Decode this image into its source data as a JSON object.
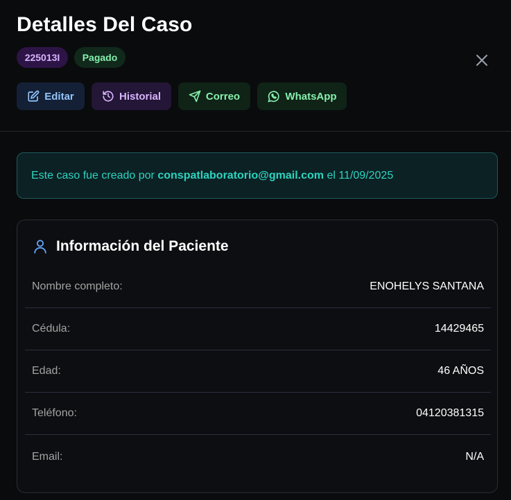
{
  "modal": {
    "title": "Detalles Del Caso",
    "case_id": "225013I",
    "status": "Pagado"
  },
  "actions": {
    "edit": "Editar",
    "history": "Historial",
    "email": "Correo",
    "whatsapp": "WhatsApp"
  },
  "notice": {
    "prefix": "Este caso fue creado por",
    "email": "conspatlaboratorio@gmail.com",
    "suffix": "el 11/09/2025"
  },
  "patient": {
    "title": "Información del Paciente",
    "fields": [
      {
        "label": "Nombre completo:",
        "value": "ENOHELYS SANTANA"
      },
      {
        "label": "Cédula:",
        "value": "14429465"
      },
      {
        "label": "Edad:",
        "value": "46 AÑOS"
      },
      {
        "label": "Teléfono:",
        "value": "04120381315"
      },
      {
        "label": "Email:",
        "value": "N/A"
      }
    ]
  },
  "colors": {
    "background": "#0a0b0d",
    "accent_teal": "#2dd4bf",
    "badge_purple": "#d8b4fe",
    "badge_green": "#86efac",
    "edit_blue": "#93c5fd"
  },
  "icons": [
    "close-icon",
    "edit-icon",
    "history-icon",
    "send-icon",
    "whatsapp-icon",
    "user-icon"
  ]
}
